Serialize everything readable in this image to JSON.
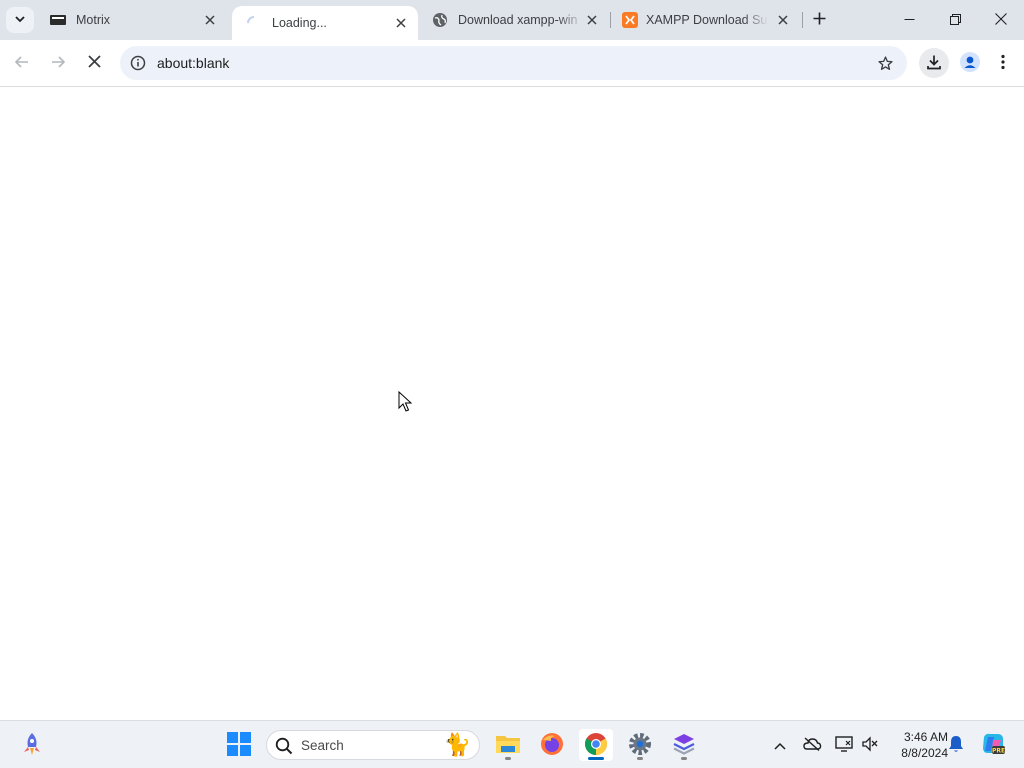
{
  "browser": {
    "tabs": [
      {
        "title": "Motrix",
        "icon": "motrix-icon",
        "active": false
      },
      {
        "title": "Loading...",
        "icon": "loading-spinner-icon",
        "active": true
      },
      {
        "title": "Download xampp-win",
        "icon": "globe-icon",
        "active": false
      },
      {
        "title": "XAMPP Download Suc",
        "icon": "xampp-icon",
        "active": false
      }
    ],
    "address_bar": {
      "url": "about:blank"
    }
  },
  "taskbar": {
    "search_placeholder": "Search",
    "clock": {
      "time": "3:46 AM",
      "date": "8/8/2024"
    },
    "pinned_apps": [
      "windows-start-icon",
      "file-explorer-icon",
      "firefox-icon",
      "chrome-icon",
      "settings-icon",
      "stack-app-icon"
    ]
  },
  "colors": {
    "tabstrip_bg": "#dfe3ea",
    "omnibox_bg": "#edf2fa",
    "taskbar_bg": "#eef1f5",
    "accent": "#0067c0",
    "xampp_orange": "#fb7a24"
  }
}
